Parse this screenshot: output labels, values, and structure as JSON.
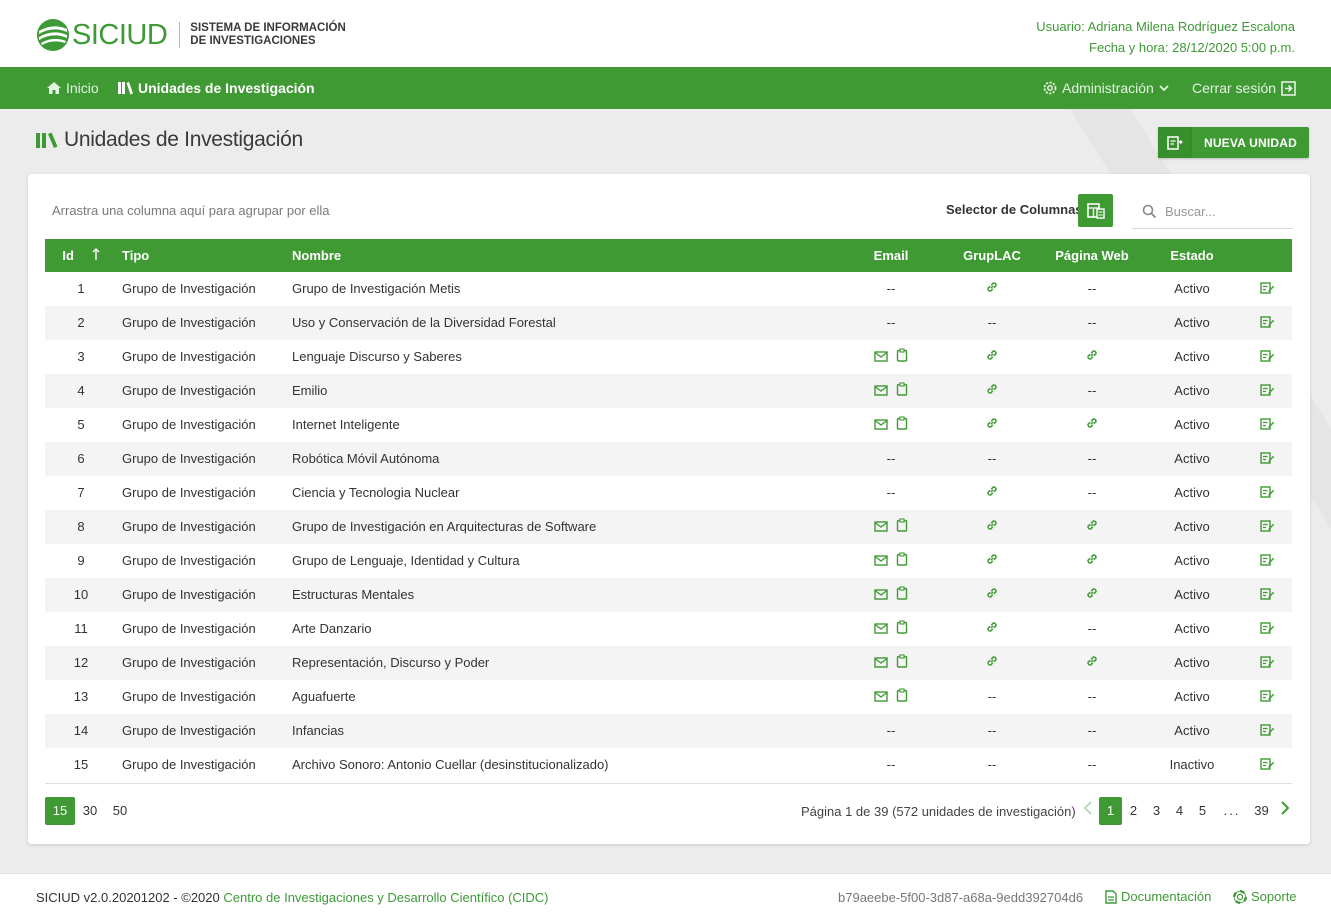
{
  "brand": {
    "name": "SICIUD",
    "subtitle_line1": "SISTEMA DE INFORMACIÓN",
    "subtitle_line2": "DE INVESTIGACIONES"
  },
  "user": {
    "line1": "Usuario: Adriana Milena Rodríguez Escalona",
    "line2": "Fecha y hora: 28/12/2020 5:00 p.m."
  },
  "nav": {
    "inicio": "Inicio",
    "unidades": "Unidades de Investigación",
    "admin": "Administración",
    "logout": "Cerrar sesión"
  },
  "page": {
    "title": "Unidades de Investigación",
    "new_button": "NUEVA UNIDAD"
  },
  "toolbar": {
    "group_hint": "Arrastra una columna aquí para agrupar por ella",
    "column_selector": "Selector de Columnas:",
    "search_placeholder": "Buscar..."
  },
  "table": {
    "headers": {
      "id": "Id",
      "tipo": "Tipo",
      "nombre": "Nombre",
      "email": "Email",
      "grup": "GrupLAC",
      "web": "Página Web",
      "estado": "Estado"
    },
    "sort_icon": "sort-ascending-icon",
    "rows": [
      {
        "id": "1",
        "tipo": "Grupo de Investigación",
        "nombre": "Grupo de Investigación Metis",
        "email": "--",
        "grup": "link",
        "web": "--",
        "estado": "Activo"
      },
      {
        "id": "2",
        "tipo": "Grupo de Investigación",
        "nombre": "Uso y Conservación de la Diversidad Forestal",
        "email": "--",
        "grup": "--",
        "web": "--",
        "estado": "Activo"
      },
      {
        "id": "3",
        "tipo": "Grupo de Investigación",
        "nombre": "Lenguaje Discurso y Saberes",
        "email": "icons",
        "grup": "link",
        "web": "link",
        "estado": "Activo"
      },
      {
        "id": "4",
        "tipo": "Grupo de Investigación",
        "nombre": "Emilio",
        "email": "icons",
        "grup": "link",
        "web": "--",
        "estado": "Activo"
      },
      {
        "id": "5",
        "tipo": "Grupo de Investigación",
        "nombre": "Internet Inteligente",
        "email": "icons",
        "grup": "link",
        "web": "link",
        "estado": "Activo"
      },
      {
        "id": "6",
        "tipo": "Grupo de Investigación",
        "nombre": "Robótica Móvil Autónoma",
        "email": "--",
        "grup": "--",
        "web": "--",
        "estado": "Activo"
      },
      {
        "id": "7",
        "tipo": "Grupo de Investigación",
        "nombre": "Ciencia y Tecnologia Nuclear",
        "email": "--",
        "grup": "link",
        "web": "--",
        "estado": "Activo"
      },
      {
        "id": "8",
        "tipo": "Grupo de Investigación",
        "nombre": "Grupo de Investigación en Arquitecturas de Software",
        "email": "icons",
        "grup": "link",
        "web": "link",
        "estado": "Activo"
      },
      {
        "id": "9",
        "tipo": "Grupo de Investigación",
        "nombre": "Grupo de Lenguaje, Identidad y Cultura",
        "email": "icons",
        "grup": "link",
        "web": "link",
        "estado": "Activo"
      },
      {
        "id": "10",
        "tipo": "Grupo de Investigación",
        "nombre": "Estructuras Mentales",
        "email": "icons",
        "grup": "link",
        "web": "link",
        "estado": "Activo"
      },
      {
        "id": "11",
        "tipo": "Grupo de Investigación",
        "nombre": "Arte Danzario",
        "email": "icons",
        "grup": "link",
        "web": "--",
        "estado": "Activo"
      },
      {
        "id": "12",
        "tipo": "Grupo de Investigación",
        "nombre": "Representación, Discurso y Poder",
        "email": "icons",
        "grup": "link",
        "web": "link",
        "estado": "Activo"
      },
      {
        "id": "13",
        "tipo": "Grupo de Investigación",
        "nombre": "Aguafuerte",
        "email": "icons",
        "grup": "--",
        "web": "--",
        "estado": "Activo"
      },
      {
        "id": "14",
        "tipo": "Grupo de Investigación",
        "nombre": "Infancias",
        "email": "--",
        "grup": "--",
        "web": "--",
        "estado": "Activo"
      },
      {
        "id": "15",
        "tipo": "Grupo de Investigación",
        "nombre": "Archivo Sonoro: Antonio Cuellar (desinstitucionalizado)",
        "email": "--",
        "grup": "--",
        "web": "--",
        "estado": "Inactivo"
      }
    ]
  },
  "pagination": {
    "page_sizes": [
      "15",
      "30",
      "50"
    ],
    "active_size": "15",
    "info": "Página 1 de 39 (572 unidades de investigación)",
    "pages": [
      "1",
      "2",
      "3",
      "4",
      "5",
      "...",
      "39"
    ],
    "active_page": "1"
  },
  "footer": {
    "version": "SICIUD v2.0.20201202 - ©2020",
    "org": "Centro de Investigaciones y Desarrollo Científico (CIDC)",
    "hash": "b79aeebe-5f00-3d87-a68a-9edd392704d6",
    "docs": "Documentación",
    "support": "Soporte"
  },
  "colors": {
    "primary": "#3f9a34",
    "brand_text": "#3d9a36",
    "background": "#ececec",
    "row_alt": "#f4f4f4"
  }
}
